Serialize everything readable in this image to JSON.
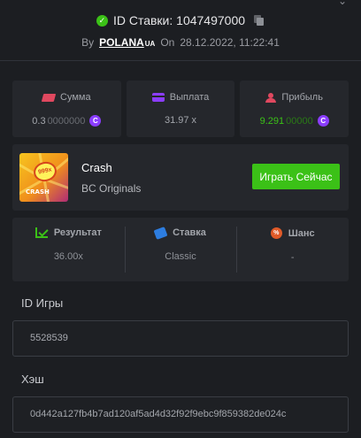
{
  "header": {
    "bet_id_label": "ID Ставки: 1047497000",
    "by_label": "By",
    "user_name": "POLANA",
    "user_country": "UA",
    "on_label": "On",
    "date": "28.12.2022, 11:22:41"
  },
  "stats": [
    {
      "label": "Сумма",
      "value_main": "0.3",
      "value_tail": "0000000",
      "coin": "C"
    },
    {
      "label": "Выплата",
      "value": "31.97 x"
    },
    {
      "label": "Прибыль",
      "value_main": "9.291",
      "value_tail": "00000",
      "coin": "C"
    }
  ],
  "game": {
    "name": "Crash",
    "provider": "BC Originals",
    "play_label": "Играть Сейчас",
    "thumb_badge": "999x",
    "thumb_word": "CRASH"
  },
  "result": {
    "columns": [
      {
        "label": "Результат",
        "value": "36.00x"
      },
      {
        "label": "Ставка",
        "value": "Classic"
      },
      {
        "label": "Шанс",
        "value": "-"
      }
    ]
  },
  "fields": {
    "game_id_label": "ID Игры",
    "game_id_value": "5528539",
    "hash_label": "Хэш",
    "hash_value": "0d442a127fb4b7ad120af5ad4d32f92f9ebc9f859382de024c"
  },
  "colors": {
    "background": "#1c1e22",
    "card": "#25272c",
    "accent_green": "#3bc117",
    "coin_purple": "#8b3dff",
    "red": "#e0485f",
    "blue": "#2d7de0",
    "orange": "#e05a28"
  },
  "icons": {
    "verified": "check-circle-icon",
    "copy": "copy-icon",
    "sum": "ticket-icon",
    "payout": "card-icon",
    "profit": "user-icon",
    "result": "chart-icon",
    "stake": "tag-icon",
    "chance": "percent-icon",
    "coin": "coin-icon"
  }
}
